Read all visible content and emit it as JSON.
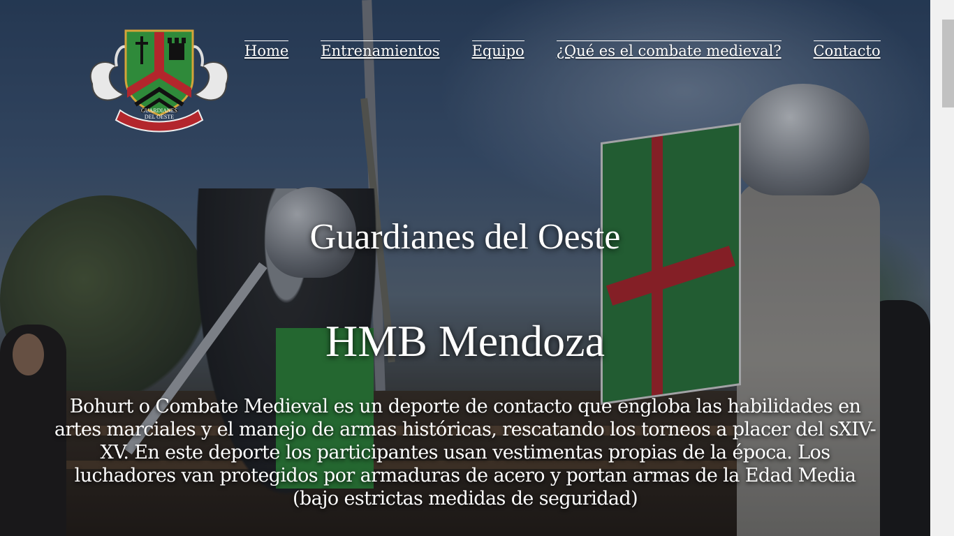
{
  "brand": {
    "logo_text_line1": "GUARDIANES",
    "logo_text_line2": "DEL OESTE",
    "colors": {
      "green": "#2f8a3a",
      "red": "#b3262c",
      "gold": "#d4a43a"
    }
  },
  "nav": {
    "items": [
      {
        "label": "Home"
      },
      {
        "label": "Entrenamientos"
      },
      {
        "label": "Equipo"
      },
      {
        "label": "¿Qué es el combate medieval?"
      },
      {
        "label": "Contacto"
      }
    ]
  },
  "hero": {
    "title": "Guardianes del Oeste",
    "subtitle": "HMB Mendoza",
    "description": "Bohurt o Combate Medieval es un deporte de contacto que engloba las habilidades en artes marciales y el manejo de armas históricas, rescatando los torneos a placer del sXIV-XV. En este deporte los participantes usan vestimentas propias de la época. Los luchadores van protegidos por armaduras de acero y portan armas de la Edad Media (bajo estrictas medidas de seguridad)"
  }
}
